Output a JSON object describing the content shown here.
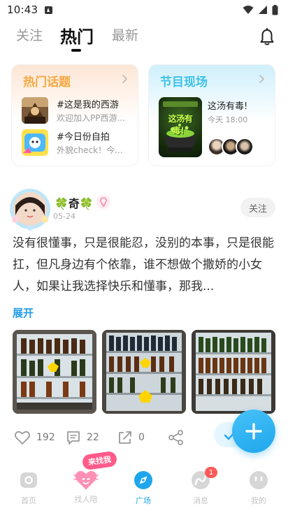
{
  "status_bar": {
    "time": "10:43"
  },
  "top_tabs": [
    {
      "label": "关注"
    },
    {
      "label": "热门"
    },
    {
      "label": "最新"
    }
  ],
  "cards": {
    "hot_topics": {
      "title": "热门话题",
      "items": [
        {
          "title": "#这是我的西游",
          "subtitle": "欢迎加入PP西游..."
        },
        {
          "title": "#今日份自拍",
          "subtitle": "外貌check！今..."
        }
      ]
    },
    "live_show": {
      "title": "节目现场",
      "poster_text": "这汤有毒！",
      "show_title": "这汤有毒!",
      "show_time": "今天 18:00"
    }
  },
  "post": {
    "author": "🍀奇🍀",
    "date": "05-24",
    "follow_label": "关注",
    "text": "没有很懂事，只是很能忍，没别的本事，只是很能扛，但凡身边有个依靠，谁不想做个撒娇的小女人，如果让我选择快乐和懂事，那我...",
    "expand_label": "展开",
    "likes": "192",
    "comments": "22",
    "shares": "0"
  },
  "bottom_nav": {
    "items": [
      {
        "label": "首页"
      },
      {
        "label": "找人陪"
      },
      {
        "label": "广场"
      },
      {
        "label": "消息",
        "badge": "1"
      },
      {
        "label": "我的"
      }
    ],
    "promo_tag": "来找我"
  },
  "colors": {
    "accent": "#1ea6ec",
    "topic_title": "#f6a64a",
    "show_title": "#3ec0ea",
    "badge": "#ff5a5a"
  }
}
